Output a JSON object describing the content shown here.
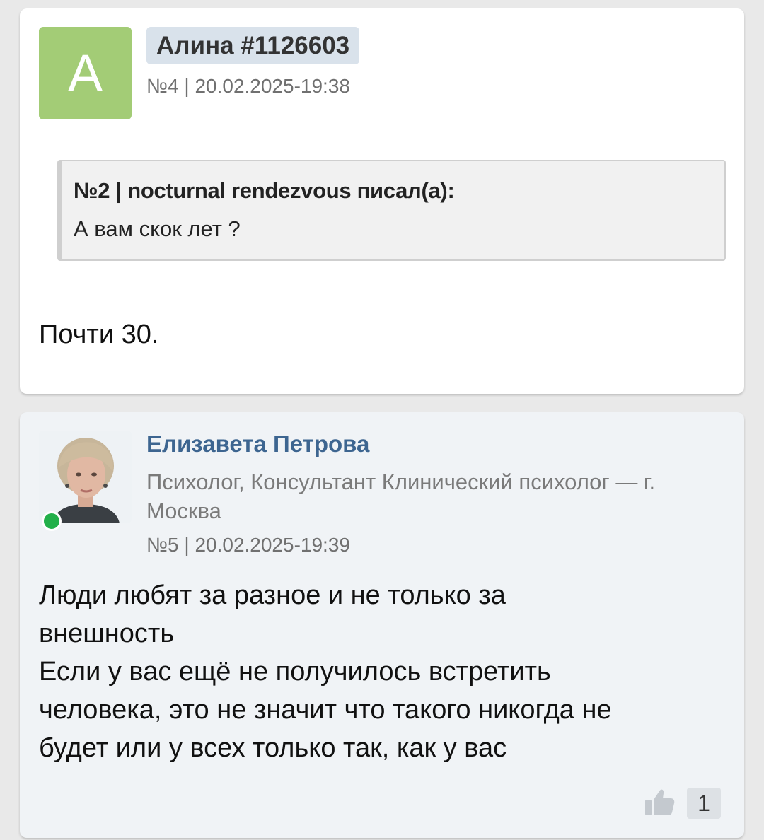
{
  "posts": [
    {
      "avatar_letter": "А",
      "author": "Алина #1126603",
      "meta": "№4 | 20.02.2025-19:38",
      "quote": {
        "header": "№2 | nocturnal rendezvous писал(а):",
        "text": "А вам скок лет ?"
      },
      "body": "Почти 30.",
      "avatar_color": "#a3cc76"
    },
    {
      "author": "Елизавета Петрова",
      "role": "Психолог, Консультант Клинический психолог — г. Москва",
      "meta": "№5 | 20.02.2025-19:39",
      "body_lines": [
        "Люди любят за разное и не только за",
        "внешность",
        "Если у вас ещё не получилось встретить",
        "человека, это не значит что такого никогда не",
        "будет или у всех только так, как у вас"
      ],
      "likes": "1",
      "online": true,
      "like_icon": "thumbs-up-icon"
    }
  ],
  "colors": {
    "author_link": "#3d6590",
    "online": "#23b04a",
    "post2_bg": "#f0f3f6"
  }
}
